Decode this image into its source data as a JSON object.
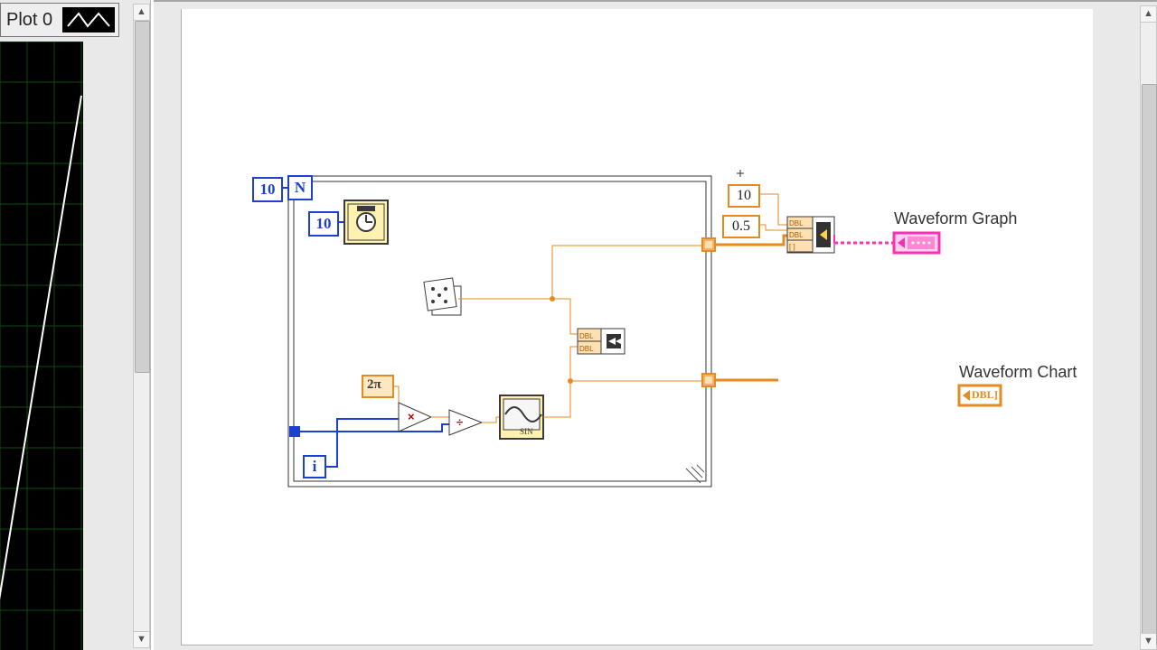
{
  "front_panel": {
    "legend_label": "Plot 0"
  },
  "diagram": {
    "loop_count": "10",
    "wait_ms": "10",
    "two_pi": "2π",
    "iter_symbol": "i",
    "n_symbol": "N",
    "t0": "10",
    "dt": "0.5",
    "sin_label": "SIN",
    "graph_label": "Waveform Graph",
    "chart_label": "Waveform Chart",
    "dbl": "DBL"
  }
}
